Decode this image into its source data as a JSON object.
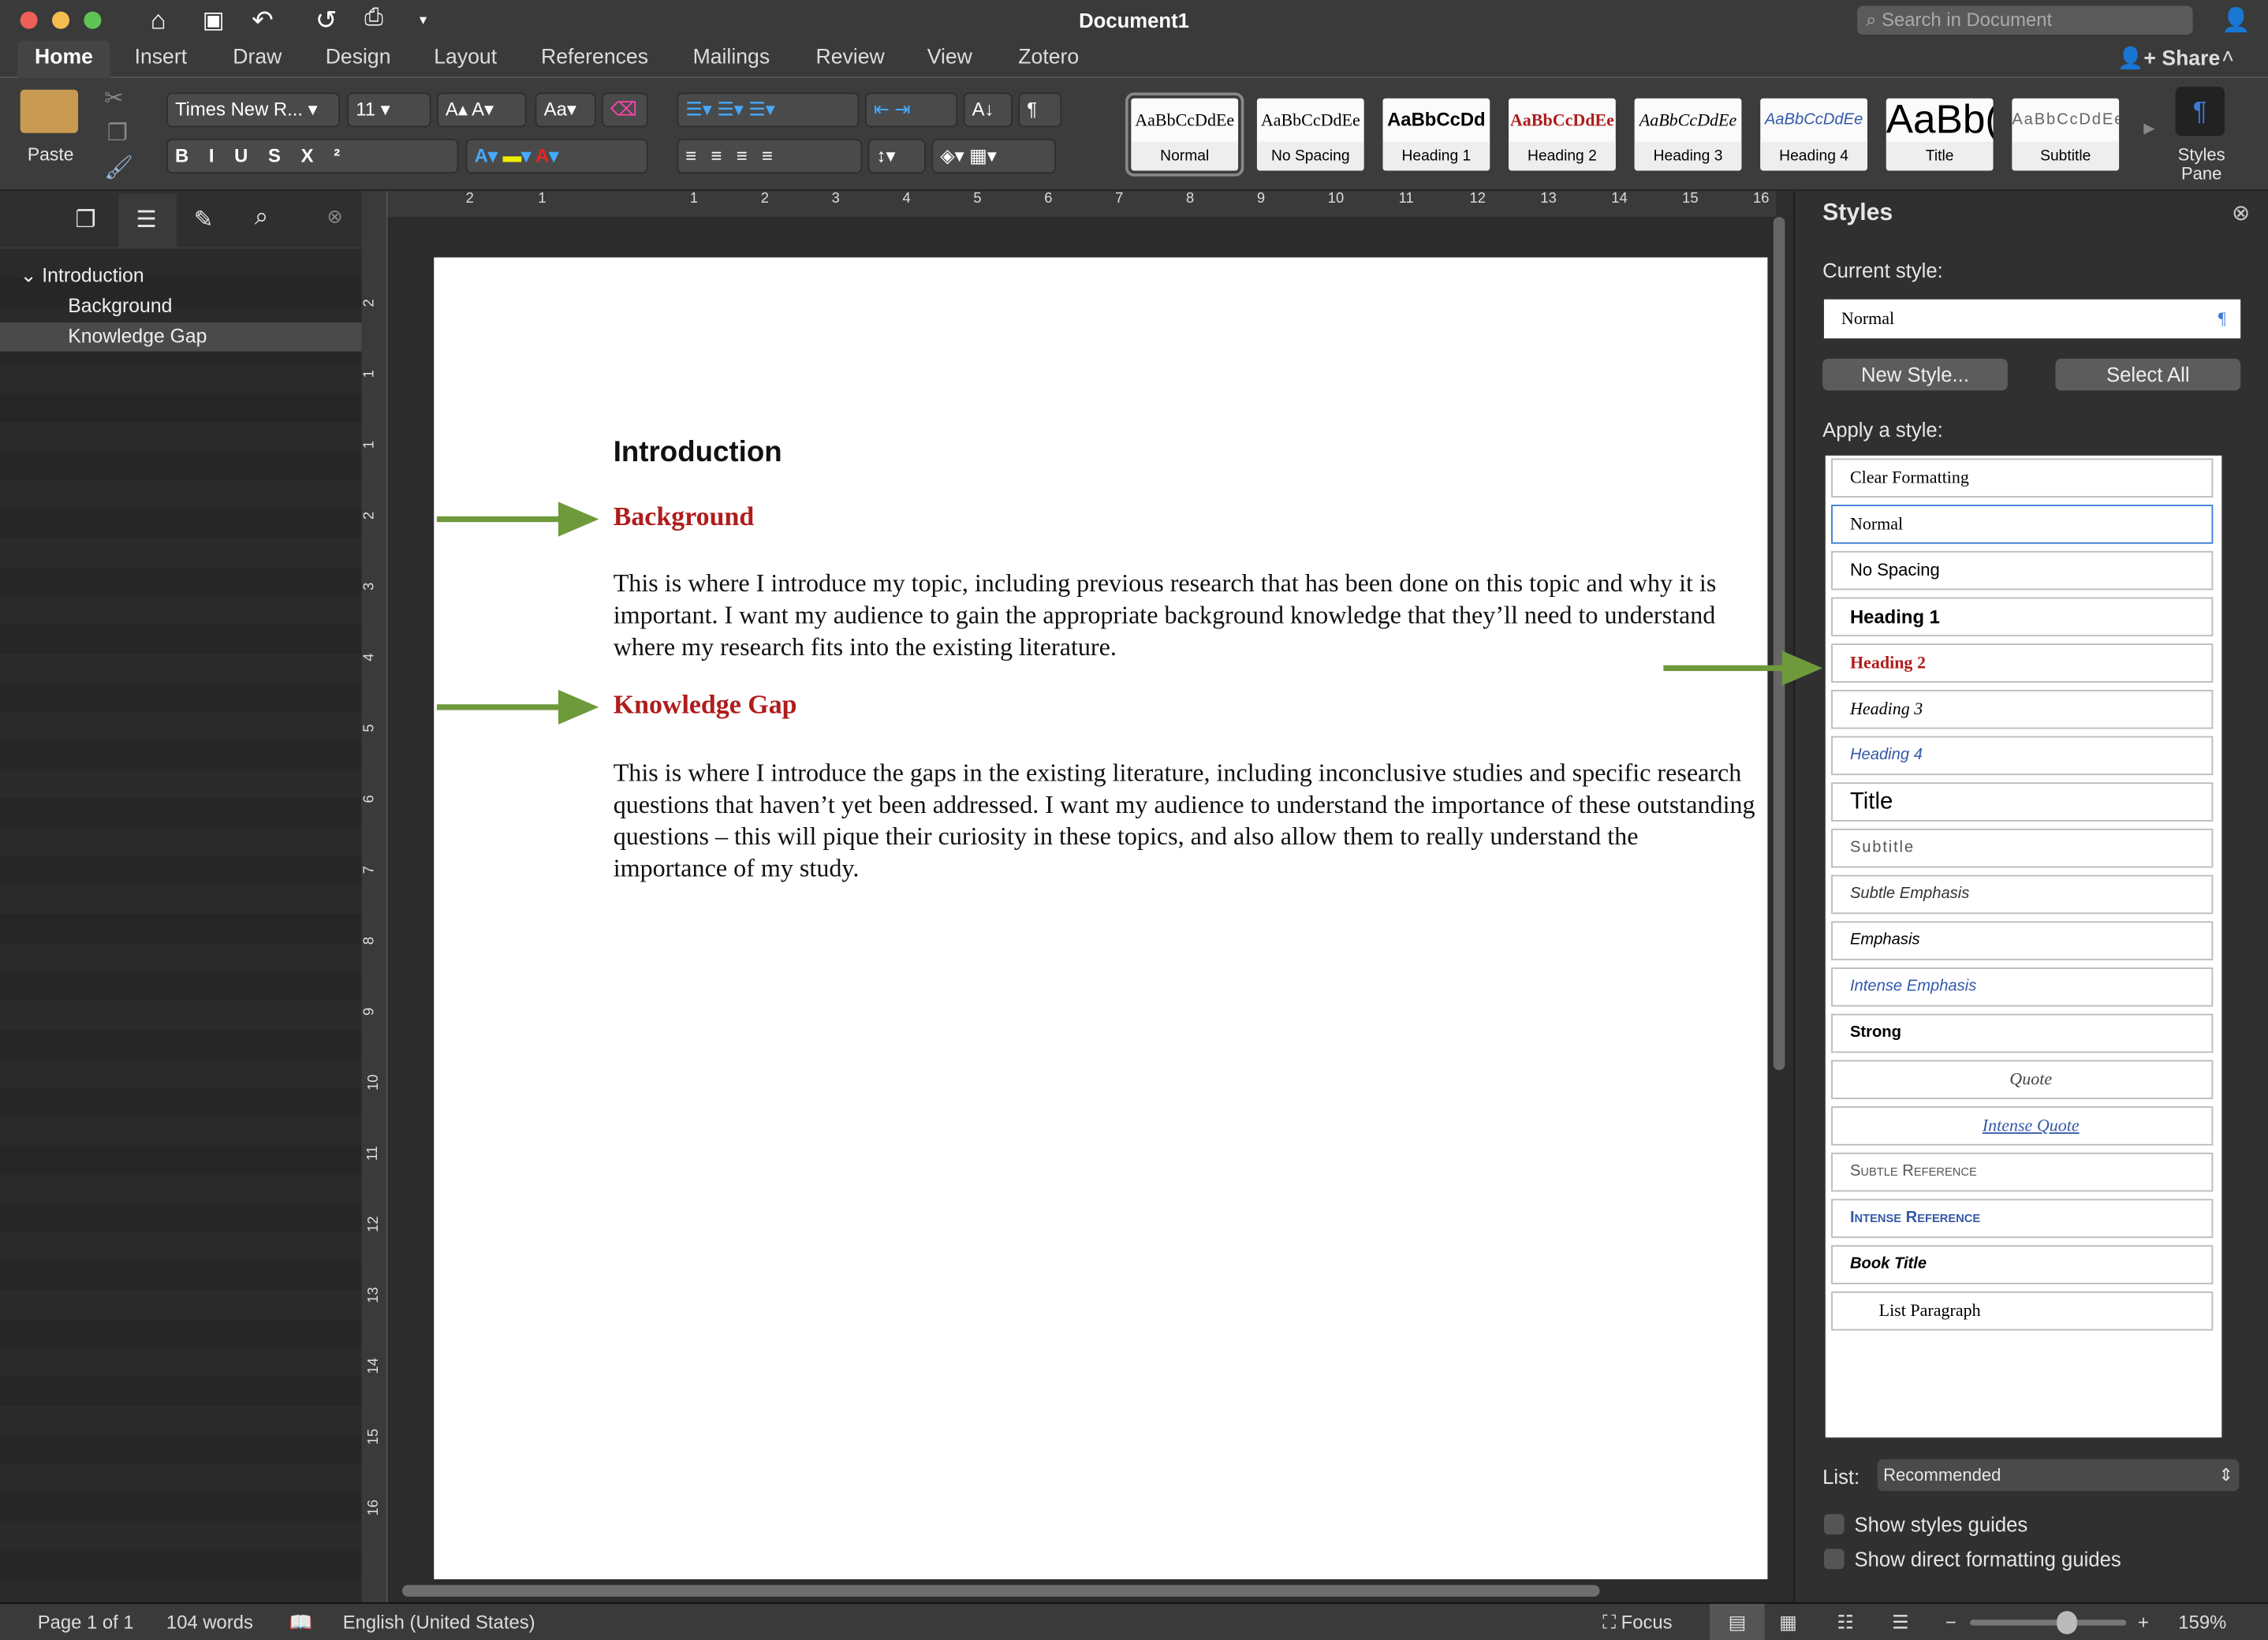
{
  "app": {
    "title": "Document1",
    "search_placeholder": "Search in Document",
    "share": "Share"
  },
  "tabs": [
    "Home",
    "Insert",
    "Draw",
    "Design",
    "Layout",
    "References",
    "Mailings",
    "Review",
    "View",
    "Zotero"
  ],
  "ribbon": {
    "paste": "Paste",
    "font": "Times New R...",
    "size": "11",
    "styles_pane": "Styles Pane",
    "gallery": [
      {
        "sample": "AaBbCcDdEe",
        "label": "Normal"
      },
      {
        "sample": "AaBbCcDdEe",
        "label": "No Spacing"
      },
      {
        "sample": "AaBbCcDd",
        "label": "Heading 1"
      },
      {
        "sample": "AaBbCcDdEe",
        "label": "Heading 2"
      },
      {
        "sample": "AaBbCcDdEe",
        "label": "Heading 3"
      },
      {
        "sample": "AaBbCcDdEe",
        "label": "Heading 4"
      },
      {
        "sample": "AaBb(",
        "label": "Title"
      },
      {
        "sample": "AaBbCcDdEe",
        "label": "Subtitle"
      }
    ]
  },
  "nav": {
    "items": [
      "Introduction",
      "Background",
      "Knowledge Gap"
    ]
  },
  "ruler": {
    "h": [
      "2",
      "1",
      "1",
      "2",
      "3",
      "4",
      "5",
      "6",
      "7",
      "8",
      "9",
      "10",
      "11",
      "12",
      "13",
      "14",
      "15",
      "16"
    ],
    "v": [
      "2",
      "1",
      "1",
      "2",
      "3",
      "4",
      "5",
      "6",
      "7",
      "8",
      "9",
      "10",
      "11",
      "12",
      "13",
      "14",
      "15",
      "16"
    ]
  },
  "document": {
    "h1": "Introduction",
    "sections": [
      {
        "heading": "Background",
        "body": "This is where I introduce my topic, including previous research that has been done on this topic and why it is important. I want my audience to gain the appropriate background knowledge that they’ll need to understand where my research fits into the existing literature."
      },
      {
        "heading": "Knowledge Gap",
        "body": "This is where I introduce the gaps in the existing literature, including inconclusive studies and specific research questions that haven’t yet been addressed. I want my audience to understand the importance of these outstanding questions – this will pique their curiosity in these topics, and also allow them to really understand the importance of my study."
      }
    ]
  },
  "styles_pane": {
    "title": "Styles",
    "current_label": "Current style:",
    "current": "Normal",
    "new_style": "New Style...",
    "select_all": "Select All",
    "apply_label": "Apply a style:",
    "items": [
      "Clear Formatting",
      "Normal",
      "No Spacing",
      "Heading 1",
      "Heading 2",
      "Heading 3",
      "Heading 4",
      "Title",
      "Subtitle",
      "Subtle Emphasis",
      "Emphasis",
      "Intense Emphasis",
      "Strong",
      "Quote",
      "Intense Quote",
      "Subtle Reference",
      "Intense Reference",
      "Book Title",
      "List Paragraph"
    ],
    "list_label": "List:",
    "list_value": "Recommended",
    "show_guides": "Show styles guides",
    "show_direct": "Show direct formatting guides"
  },
  "status": {
    "page": "Page 1 of 1",
    "words": "104 words",
    "language": "English (United States)",
    "focus": "Focus",
    "zoom": "159%",
    "zoom_level": 0.62
  },
  "colors": {
    "heading2": "#b01c1c",
    "arrow": "#6e9a3c",
    "accent": "#3b7bd8"
  }
}
